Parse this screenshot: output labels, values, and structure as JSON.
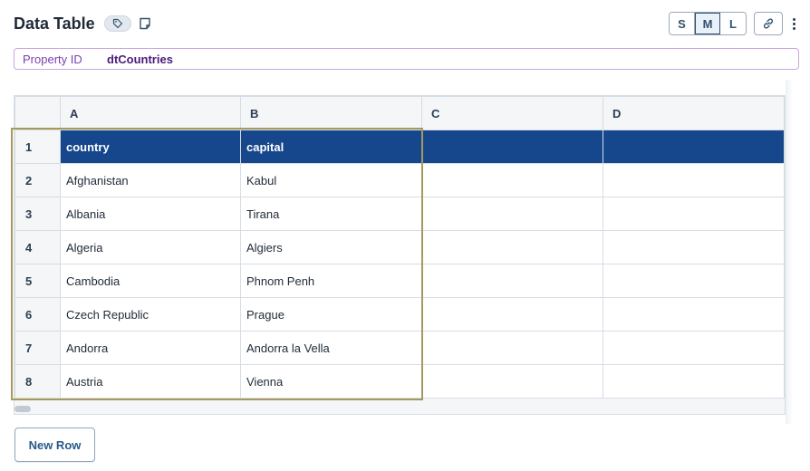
{
  "header": {
    "title": "Data Table",
    "size_options": [
      "S",
      "M",
      "L"
    ],
    "selected_size": "M",
    "icons": {
      "tag": "tag-icon",
      "note": "note-icon",
      "link": "link-icon",
      "more": "more-vertical-icon"
    }
  },
  "property": {
    "label": "Property ID",
    "value": "dtCountries"
  },
  "grid": {
    "columns": [
      "A",
      "B",
      "C",
      "D"
    ],
    "rows": [
      {
        "num": "1",
        "cells": [
          "country",
          "capital",
          "",
          ""
        ],
        "is_header": true
      },
      {
        "num": "2",
        "cells": [
          "Afghanistan",
          "Kabul",
          "",
          ""
        ]
      },
      {
        "num": "3",
        "cells": [
          "Albania",
          "Tirana",
          "",
          ""
        ]
      },
      {
        "num": "4",
        "cells": [
          "Algeria",
          "Algiers",
          "",
          ""
        ]
      },
      {
        "num": "5",
        "cells": [
          "Cambodia",
          "Phnom Penh",
          "",
          ""
        ]
      },
      {
        "num": "6",
        "cells": [
          "Czech Republic",
          "Prague",
          "",
          ""
        ]
      },
      {
        "num": "7",
        "cells": [
          "Andorra",
          "Andorra la Vella",
          "",
          ""
        ]
      },
      {
        "num": "8",
        "cells": [
          "Austria",
          "Vienna",
          "",
          ""
        ]
      }
    ],
    "colors": {
      "header_row_bg": "#16468c",
      "selection_border": "#a59a5a"
    }
  },
  "actions": {
    "new_row_label": "New Row"
  }
}
